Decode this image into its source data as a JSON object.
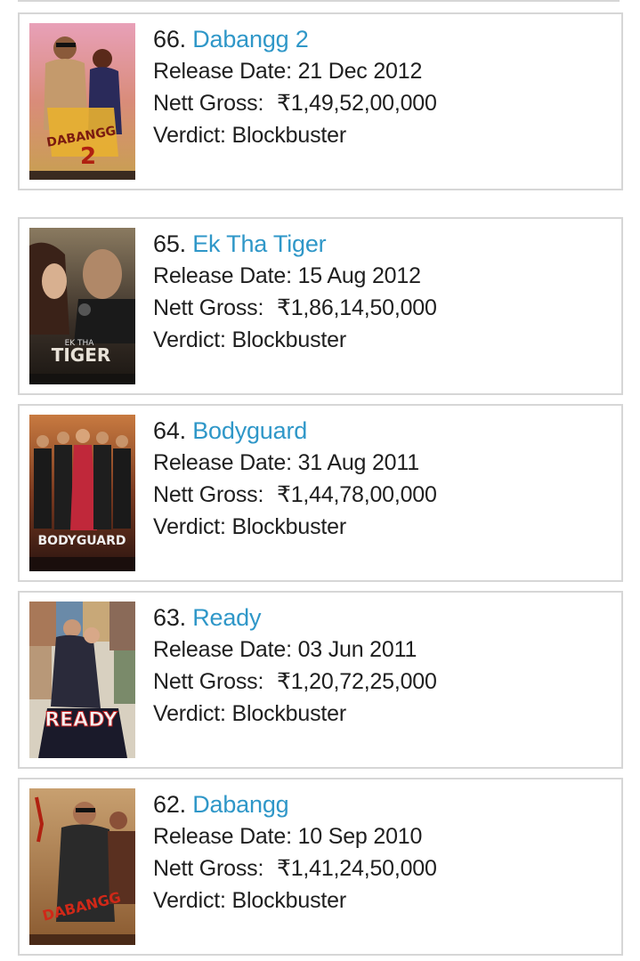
{
  "labels": {
    "release_date": "Release Date: ",
    "nett_gross": "Nett Gross: ",
    "verdict": "Verdict: ",
    "rupee_symbol": "₹"
  },
  "movies": [
    {
      "rank": "66.",
      "title": "Dabangg 2",
      "release_date": "21 Dec 2012",
      "nett_gross": "1,49,52,00,000",
      "verdict": "Blockbuster",
      "poster_text": "DABANGG"
    },
    {
      "rank": "65.",
      "title": "Ek Tha Tiger",
      "release_date": "15 Aug 2012",
      "nett_gross": "1,86,14,50,000",
      "verdict": "Blockbuster",
      "poster_text": "TIGER",
      "poster_subtext": "EK THA"
    },
    {
      "rank": "64.",
      "title": "Bodyguard",
      "release_date": "31 Aug 2011",
      "nett_gross": "1,44,78,00,000",
      "verdict": "Blockbuster",
      "poster_text": "BODYGUARD"
    },
    {
      "rank": "63.",
      "title": "Ready",
      "release_date": "03 Jun 2011",
      "nett_gross": "1,20,72,25,000",
      "verdict": "Blockbuster",
      "poster_text": "READY"
    },
    {
      "rank": "62.",
      "title": "Dabangg",
      "release_date": "10 Sep 2010",
      "nett_gross": "1,41,24,50,000",
      "verdict": "Blockbuster",
      "poster_text": "DABANGG"
    }
  ]
}
